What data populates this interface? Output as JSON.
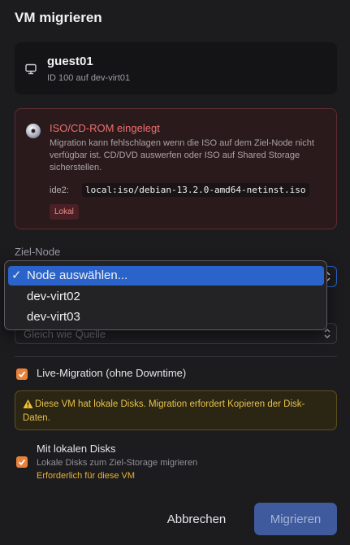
{
  "dialog": {
    "title": "VM migrieren"
  },
  "vm": {
    "name": "guest01",
    "subtitle": "ID 100 auf dev-virt01"
  },
  "iso_warning": {
    "title": "ISO/CD-ROM eingelegt",
    "text": "Migration kann fehlschlagen wenn die ISO auf dem Ziel-Node nicht verfügbar ist. CD/DVD auswerfen oder ISO auf Shared Storage sicherstellen.",
    "device": "ide2:",
    "path": "local:iso/debian-13.2.0-amd64-netinst.iso",
    "badge": "Lokal"
  },
  "target_node": {
    "label": "Ziel-Node",
    "selected": "Node auswählen...",
    "options": [
      "Node auswählen...",
      "dev-virt02",
      "dev-virt03"
    ]
  },
  "storage": {
    "value": "Gleich wie Quelle"
  },
  "live_migration": {
    "label": "Live-Migration (ohne Downtime)",
    "checked": true
  },
  "disk_warning": {
    "text": "Diese VM hat lokale Disks. Migration erfordert Kopieren der Disk-Daten."
  },
  "local_disks": {
    "label": "Mit lokalen Disks",
    "sub": "Lokale Disks zum Ziel-Storage migrieren",
    "required": "Erforderlich für diese VM",
    "checked": true
  },
  "actions": {
    "cancel": "Abbrechen",
    "migrate": "Migrieren"
  },
  "colors": {
    "accent": "#e8813a",
    "primary": "#3f5a9d",
    "danger": "#ef6e6e",
    "warning": "#e6c24a",
    "selection": "#2a63c9"
  }
}
